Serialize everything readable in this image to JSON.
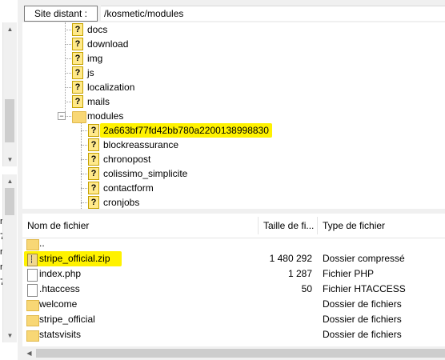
{
  "path_bar": {
    "label": "Site distant :",
    "value": "/kosmetic/modules"
  },
  "tree": {
    "items": [
      {
        "label": "docs",
        "icon": "unknown-folder-icon"
      },
      {
        "label": "download",
        "icon": "unknown-folder-icon"
      },
      {
        "label": "img",
        "icon": "unknown-folder-icon"
      },
      {
        "label": "js",
        "icon": "unknown-folder-icon"
      },
      {
        "label": "localization",
        "icon": "unknown-folder-icon"
      },
      {
        "label": "mails",
        "icon": "unknown-folder-icon"
      },
      {
        "label": "modules",
        "icon": "folder-icon"
      }
    ],
    "children": [
      {
        "label": "2a663bf77fd42bb780a2200138998830",
        "icon": "unknown-folder-icon"
      },
      {
        "label": "blockreassurance",
        "icon": "unknown-folder-icon"
      },
      {
        "label": "chronopost",
        "icon": "unknown-folder-icon"
      },
      {
        "label": "colissimo_simplicite",
        "icon": "unknown-folder-icon"
      },
      {
        "label": "contactform",
        "icon": "unknown-folder-icon"
      },
      {
        "label": "cronjobs",
        "icon": "unknown-folder-icon"
      }
    ],
    "highlight_color": "#fff200"
  },
  "file_list": {
    "columns": [
      "Nom de fichier",
      "Taille de fi...",
      "Type de fichier"
    ],
    "rows": [
      {
        "name": "..",
        "size": "",
        "type": "",
        "icon": "folder-icon"
      },
      {
        "name": "stripe_official.zip",
        "size": "1 480 292",
        "type": "Dossier compressé",
        "icon": "zip-file-icon"
      },
      {
        "name": "index.php",
        "size": "1 287",
        "type": "Fichier PHP",
        "icon": "file-icon"
      },
      {
        "name": ".htaccess",
        "size": "50",
        "type": "Fichier HTACCESS",
        "icon": "file-icon"
      },
      {
        "name": "welcome",
        "size": "",
        "type": "Dossier de fichiers",
        "icon": "folder-icon"
      },
      {
        "name": "stripe_official",
        "size": "",
        "type": "Dossier de fichiers",
        "icon": "folder-icon"
      },
      {
        "name": "statsvisits",
        "size": "",
        "type": "Dossier de fichiers",
        "icon": "folder-icon"
      }
    ]
  },
  "left_edge_fragments": [
    "r",
    "7",
    "r",
    "r",
    "7"
  ]
}
